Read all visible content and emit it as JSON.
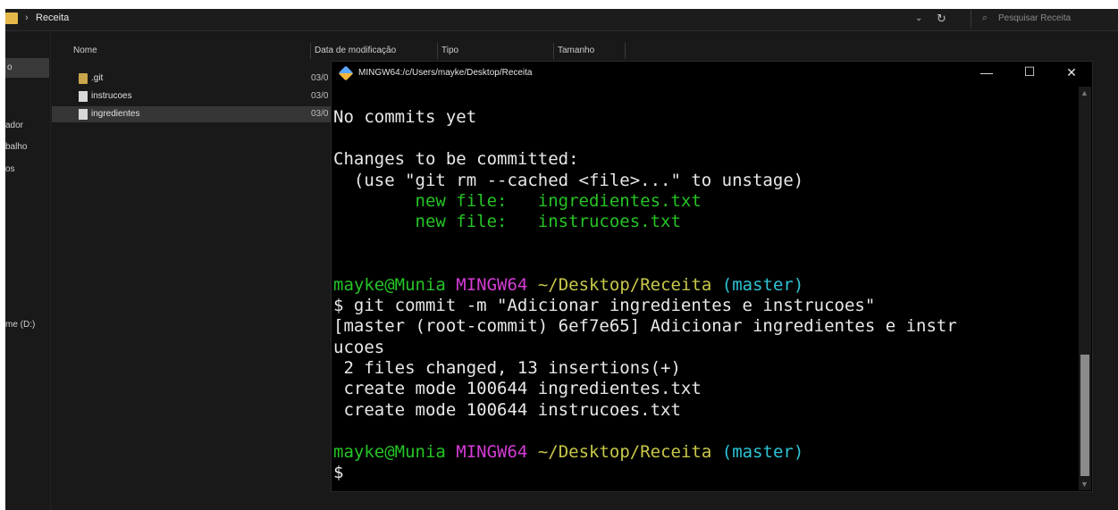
{
  "explorer": {
    "breadcrumb_sep": "›",
    "breadcrumb": "Receita",
    "search_placeholder": "Pesquisar Receita",
    "sidebar": [
      {
        "label": "o"
      },
      {
        "label": "ador"
      },
      {
        "label": "balho"
      },
      {
        "label": "os"
      },
      {
        "label": "me (D:)"
      }
    ],
    "columns": [
      "Nome",
      "Data de modificação",
      "Tipo",
      "Tamanho"
    ],
    "files": [
      {
        "name": ".git",
        "icon": "folder-icon",
        "date": "03/0"
      },
      {
        "name": "instrucoes",
        "icon": "text-file-icon",
        "date": "03/0"
      },
      {
        "name": "ingredientes",
        "icon": "text-file-icon",
        "date": "03/0"
      }
    ]
  },
  "terminal": {
    "title": "MINGW64:/c/Users/mayke/Desktop/Receita",
    "controls": {
      "minimize": "—",
      "maximize": "☐",
      "close": "✕"
    },
    "lines": {
      "l1": "No commits yet",
      "l3": "Changes to be committed:",
      "l4": "  (use \"git rm --cached <file>...\" to unstage)",
      "l5a": "        new file:   ",
      "l5b": "ingredientes.txt",
      "l6a": "        new file:   ",
      "l6b": "instrucoes.txt",
      "p1_user": "mayke@Munia",
      "p1_sys": "MINGW64",
      "p1_path": "~/Desktop/Receita",
      "p1_branch": "(master)",
      "cmd": "$ git commit -m \"Adicionar ingredientes e instrucoes\"",
      "out1": "[master (root-commit) 6ef7e65] Adicionar ingredientes e instr",
      "out2": "ucoes",
      "out3": " 2 files changed, 13 insertions(+)",
      "out4": " create mode 100644 ingredientes.txt",
      "out5": " create mode 100644 instrucoes.txt",
      "p2_user": "mayke@Munia",
      "p2_sys": "MINGW64",
      "p2_path": "~/Desktop/Receita",
      "p2_branch": "(master)",
      "prompt": "$"
    },
    "colors": {
      "staged": "#25c425",
      "user": "#25c425",
      "system": "#d43cd4",
      "path": "#c8c84a",
      "branch": "#2ec4d6"
    }
  }
}
